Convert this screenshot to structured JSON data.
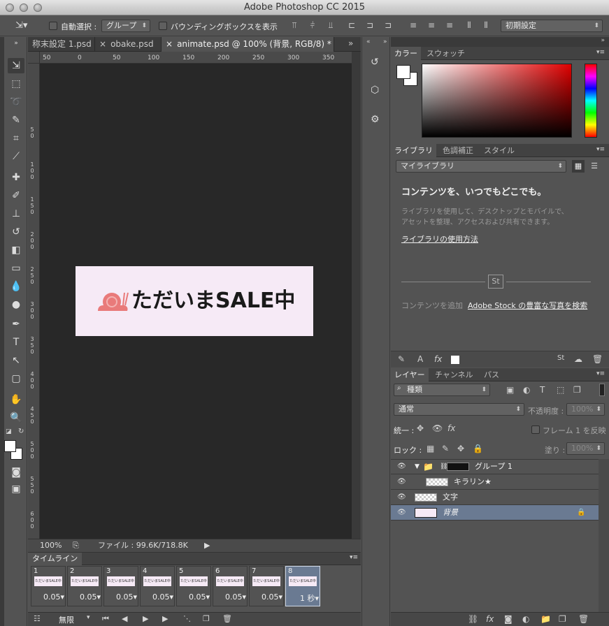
{
  "app": {
    "title": "Adobe Photoshop CC 2015"
  },
  "options": {
    "auto_select_label": "自動選択 :",
    "auto_select_value": "グループ",
    "bbox_label": "バウンディングボックスを表示",
    "workspace": "初期設定"
  },
  "tabs": [
    {
      "label": "称末設定 1.psd"
    },
    {
      "label": "obake.psd"
    },
    {
      "label": "animate.psd @ 100% (背景, RGB/8) *"
    }
  ],
  "ruler": {
    "h_ticks": [
      "50",
      "0",
      "50",
      "100",
      "150",
      "200",
      "250",
      "300",
      "350"
    ],
    "v_ticks": [
      "5 0",
      "1 0 0",
      "1 5 0",
      "2 0 0",
      "2 5 0",
      "3 0 0",
      "3 5 0",
      "4 0 0",
      "4 5 0",
      "5 0 0",
      "5 5 0",
      "6 0 0",
      "6 5 0"
    ]
  },
  "canvas": {
    "text": "ただいまSALE中",
    "bg_color": "#f6eaf6",
    "snail_color": "#e97a7a"
  },
  "status": {
    "zoom": "100%",
    "file": "ファイル : 99.6K/718.8K"
  },
  "timeline": {
    "title": "タイムライン",
    "frames": [
      {
        "num": "1",
        "delay": "0.05▾"
      },
      {
        "num": "2",
        "delay": "0.05▾"
      },
      {
        "num": "3",
        "delay": "0.05▾"
      },
      {
        "num": "4",
        "delay": "0.05▾"
      },
      {
        "num": "5",
        "delay": "0.05▾"
      },
      {
        "num": "6",
        "delay": "0.05▾"
      },
      {
        "num": "7",
        "delay": "0.05▾"
      },
      {
        "num": "8",
        "delay": "1 秒▾"
      }
    ],
    "thumb_text": "ただいまSALE中",
    "loop": "無限"
  },
  "color_panel": {
    "tabs": [
      "カラー",
      "スウォッチ"
    ]
  },
  "library_panel": {
    "tabs": [
      "ライブラリ",
      "色調補正",
      "スタイル"
    ],
    "dropdown": "マイライブラリ",
    "heading": "コンテンツを、いつでもどこでも。",
    "body1": "ライブラリを使用して、デスクトップとモバイルで、",
    "body2": "アセットを整理、アクセスおよび共有できます。",
    "link": "ライブラリの使用方法",
    "stock_icon": "St",
    "add_label": "コンテンツを追加",
    "stock_link": "Adobe Stock の豊富な写真を検索"
  },
  "layers_panel": {
    "tabs": [
      "レイヤー",
      "チャンネル",
      "パス"
    ],
    "filter": "種類",
    "blend": "通常",
    "opacity_label": "不透明度 :",
    "opacity_value": "100%",
    "unify_label": "統一 :",
    "propagate_label": "フレーム 1 を反映",
    "lock_label": "ロック :",
    "fill_label": "塗り :",
    "fill_value": "100%",
    "layers": [
      {
        "name": "グループ 1"
      },
      {
        "name": "キラリン★"
      },
      {
        "name": "文字"
      },
      {
        "name": "背景"
      }
    ]
  }
}
